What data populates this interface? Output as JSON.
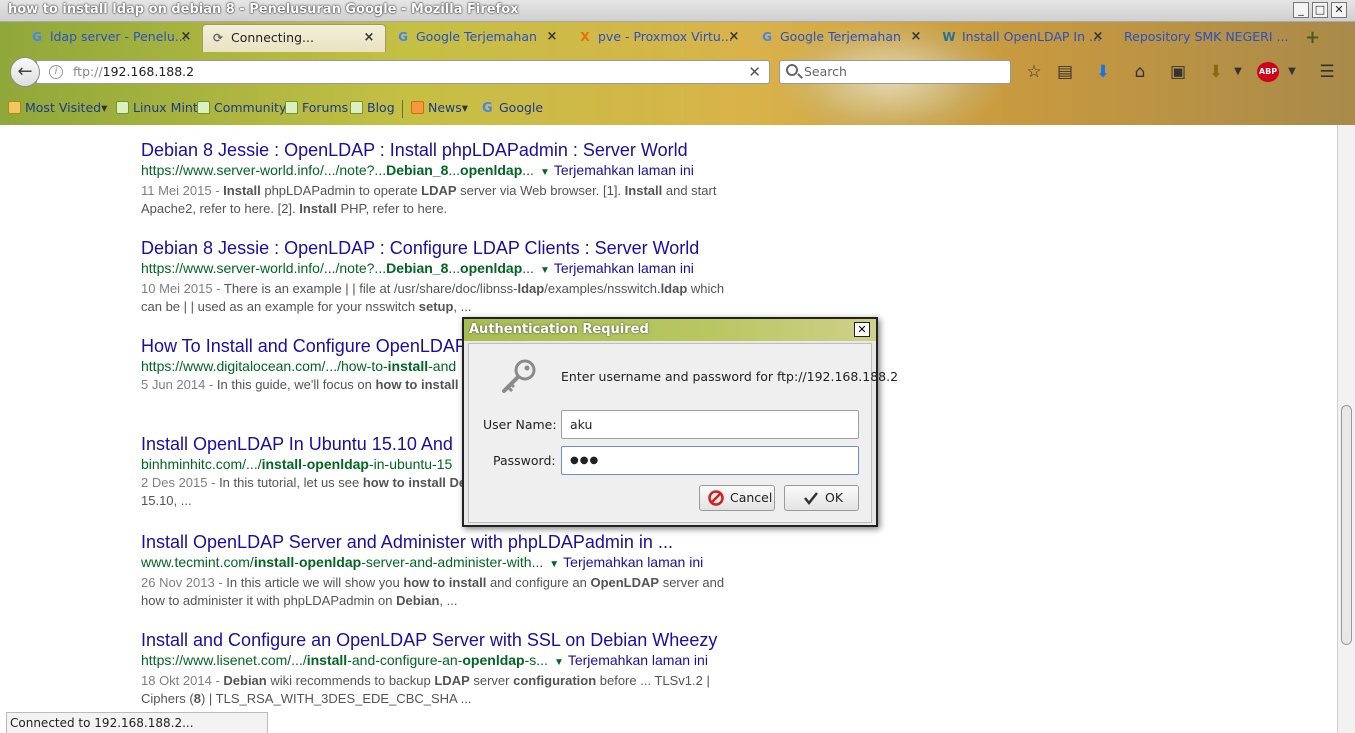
{
  "window": {
    "title": "how to install ldap on debian 8 - Penelusuran Google - Mozilla Firefox",
    "buttons": [
      "_",
      "□",
      "✕"
    ]
  },
  "tabs": [
    {
      "label": "ldap server - Penelu...",
      "icon": "G",
      "icon_color": "#4285f4"
    },
    {
      "label": "Connecting...",
      "icon": "⟳",
      "icon_color": "#666666",
      "active": true
    },
    {
      "label": "Google Terjemahan",
      "icon": "G",
      "icon_color": "#4285f4"
    },
    {
      "label": "pve - Proxmox Virtu...",
      "icon": "X",
      "icon_color": "#e57000"
    },
    {
      "label": "Google Terjemahan",
      "icon": "G",
      "icon_color": "#4285f4"
    },
    {
      "label": "Install OpenLDAP In ...",
      "icon": "W",
      "icon_color": "#21759b"
    },
    {
      "label": "Repository SMK NEGERI ...",
      "icon": "",
      "icon_color": "#888888"
    }
  ],
  "tab_close": "×",
  "new_tab": "+",
  "navbar": {
    "back": "←",
    "url_scheme": "ftp://",
    "url_host": "192.168.188.2",
    "stop": "✕",
    "search_placeholder": "Search",
    "icons": [
      "☆",
      "▤",
      "⬇",
      "⌂",
      "▣",
      "⬇",
      "ABP",
      "☰"
    ]
  },
  "bookmarks": [
    {
      "label": "Most Visited",
      "type": "folder",
      "dropdown": "▾"
    },
    {
      "label": "Linux Mint",
      "type": "page"
    },
    {
      "label": "Community",
      "type": "page"
    },
    {
      "label": "Forums",
      "type": "page"
    },
    {
      "label": "Blog",
      "type": "page"
    },
    {
      "label": "News",
      "type": "rss",
      "dropdown": "▾"
    },
    {
      "label": "Google",
      "type": "google"
    }
  ],
  "results": [
    {
      "title": "Debian 8 Jessie : OpenLDAP : Install phpLDAPadmin : Server World",
      "url_html": "https://www.server-world.info/.../note?...<b>Debian_8</b>...<b>openldap</b>...",
      "translate": "Terjemahkan laman ini",
      "date": "11 Mei 2015",
      "snippet_html": "<b>Install</b> phpLDAPadmin to operate <b>LDAP</b> server via Web browser. [1]. <b>Install</b> and start Apache2, refer to here. [2]. <b>Install</b> PHP, refer to here."
    },
    {
      "title": "Debian 8 Jessie : OpenLDAP : Configure LDAP Clients : Server World",
      "url_html": "https://www.server-world.info/.../note?...<b>Debian_8</b>...<b>openldap</b>...",
      "translate": "Terjemahkan laman ini",
      "date": "10 Mei 2015",
      "snippet_html": "There is an example | | file at /usr/share/doc/libnss-<b>ldap</b>/examples/nsswitch.<b>ldap</b> which can be | | used as an example for your nsswitch <b>setup</b>, ..."
    },
    {
      "title": "How To Install and Configure OpenLDAP",
      "url_html": "https://www.digitalocean.com/.../how-to-<b>install</b>-and",
      "translate": "",
      "date": "5 Jun 2014",
      "snippet_html": "In this guide, we'll focus on <b>how to install</b> server. We will then <b>install</b> and configure ..."
    },
    {
      "title": "Install OpenLDAP In Ubuntu 15.10 And",
      "url_html": "binhminhitc.com/.../<b>install</b>-<b>openldap</b>-in-ubuntu-15",
      "translate": "",
      "date": "2 Des 2015",
      "snippet_html": "In this tutorial, let us see <b>how to install</b> <b>Debian</b> server. I tested this tutorial in Ubuntu 15.10, ..."
    },
    {
      "title": "Install OpenLDAP Server and Administer with phpLDAPadmin in ...",
      "url_html": "www.tecmint.com/<b>install</b>-<b>openldap</b>-server-and-administer-with...",
      "translate": "Terjemahkan laman ini",
      "date": "26 Nov 2013",
      "snippet_html": "In this article we will show you <b>how to install</b> and configure an <b>OpenLDAP</b> server and how to administer it with phpLDAPadmin on <b>Debian</b>, ..."
    },
    {
      "title": "Install and Configure an OpenLDAP Server with SSL on Debian Wheezy",
      "url_html": "https://www.lisenet.com/.../<b>install</b>-and-configure-an-<b>openldap</b>-s...",
      "translate": "Terjemahkan laman ini",
      "date": "18 Okt 2014",
      "snippet_html": "<b>Debian</b> wiki recommends to backup <b>LDAP</b> server <b>configuration</b> before ... TLSv1.2 | Ciphers (<b>8</b>) | TLS_RSA_WITH_3DES_EDE_CBC_SHA ..."
    }
  ],
  "date_sep": " - ",
  "status": "Connected to 192.168.188.2...",
  "dialog": {
    "title": "Authentication Required",
    "close": "✕",
    "message": "Enter username and password for ftp://192.168.188.2",
    "username_label": "User Name:",
    "username_value": "aku",
    "password_label": "Password:",
    "password_value": "●●●",
    "cancel_label": "Cancel",
    "ok_label": "OK"
  },
  "colors": {
    "link": "#1a0dab",
    "url_green": "#006621",
    "snippet": "#545454",
    "accent_green": "#a6bd52"
  }
}
